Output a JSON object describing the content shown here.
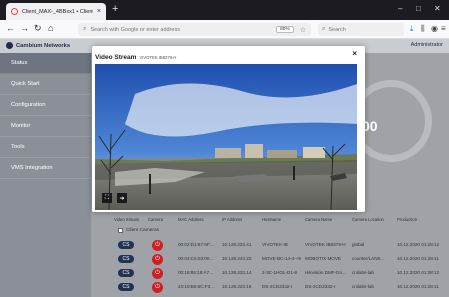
{
  "browser": {
    "tab_title": "Client_MAX-_4BBxx1 • Client",
    "tab_close": "×",
    "new_tab": "+",
    "url_placeholder": "Search with Google or enter address",
    "zoom": "80%",
    "search_placeholder": "Search",
    "win_min": "–",
    "win_max": "□",
    "win_close": "✕"
  },
  "app": {
    "brand": "Cambium Networks",
    "admin_label": "Administrator",
    "sidebar": [
      "Status",
      "Quick Start",
      "Configuration",
      "Monitor",
      "Tools",
      "VMS Integration"
    ],
    "table_headers": [
      "Video Stream",
      "Camera",
      "MAC Address",
      "IP Address",
      "Hostname",
      "Camera Name",
      "Camera Location",
      "Production"
    ],
    "client_cameras_label": "Client Cameras",
    "rows": [
      {
        "mac": "00:02:D1:87:6F:...",
        "ip": "10.128.223.41",
        "host": "VIVOTEK-IB",
        "name": "VIVOTEK IB8379-H",
        "loc": "global",
        "date": "10.12.2020 01:28:12"
      },
      {
        "mac": "00:03:C5:03:00...",
        "ip": "10.128.223.20",
        "host": "MOVE-BC-14-4-+9",
        "name": "MOBOTIX MOVE",
        "loc": "counter/LAN8...",
        "date": "10.12.2020 01:28:11"
      },
      {
        "mac": "00:18:85:18:A7...",
        "ip": "10.128.223.14",
        "host": "2-3C-1HOL-D1-8",
        "name": "Hikvision DMF-Do...",
        "loc": "cnilabs-lab",
        "date": "10.12.2020 01:28:12"
      },
      {
        "mac": "44:19:B6:5C:F3...",
        "ip": "10.128.223.16",
        "host": "DS-2CD2332-I",
        "name": "DS-2CD2332-I",
        "loc": "cnilabs-lab",
        "date": "10.12.2020 01:28:11"
      }
    ],
    "pill_label": "CS",
    "gauge_value": "00"
  },
  "modal": {
    "title": "Video Stream",
    "subtitle": "VIVOTEK IB8379-H",
    "close": "×"
  },
  "colors": {
    "accent": "#1f3352",
    "danger": "#d11d24",
    "sidebar": "#8b9098"
  }
}
